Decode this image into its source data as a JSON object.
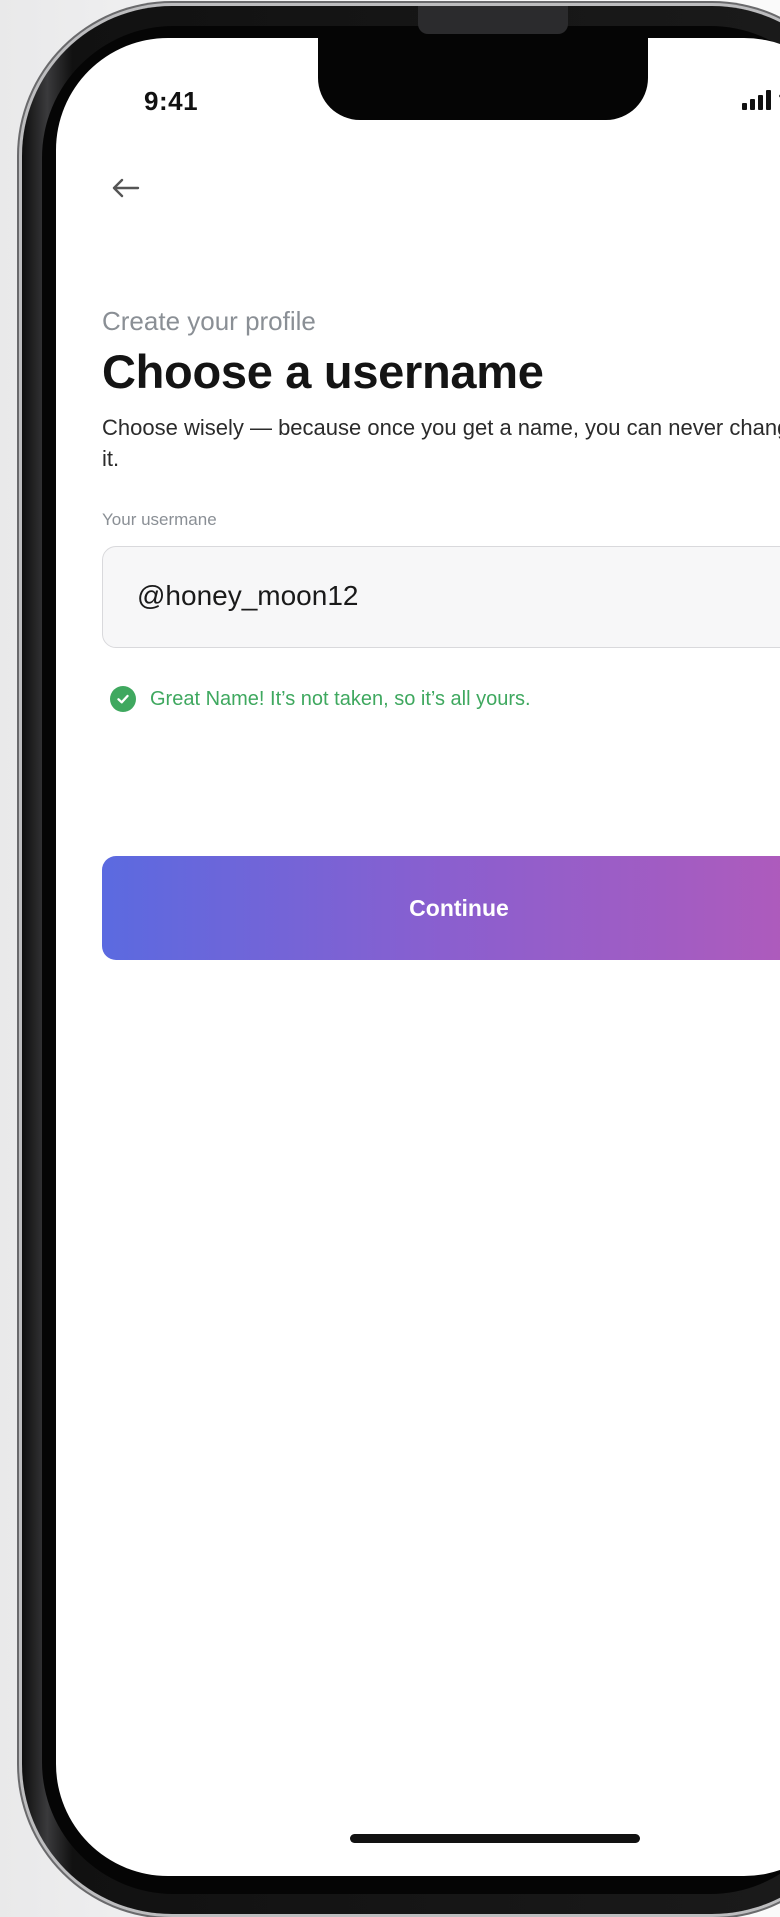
{
  "status_bar": {
    "time": "9:41",
    "signal_icon": "cellular-signal-icon",
    "wifi_icon": "wifi-icon"
  },
  "nav": {
    "back_icon": "arrow-left-icon"
  },
  "profile": {
    "step_label": "Create your profile",
    "title": "Choose a username",
    "description": "Choose wisely — because once you get a name, you can never change it."
  },
  "username_field": {
    "label": "Your usermane",
    "value": "@honey_moon12"
  },
  "validation": {
    "icon": "check-circle-icon",
    "message": "Great Name! It’s not taken, so it’s all yours.",
    "color": "#3fa85f"
  },
  "actions": {
    "continue_label": "Continue",
    "gradient_start": "#5b6ae0",
    "gradient_end": "#b65ab8"
  }
}
